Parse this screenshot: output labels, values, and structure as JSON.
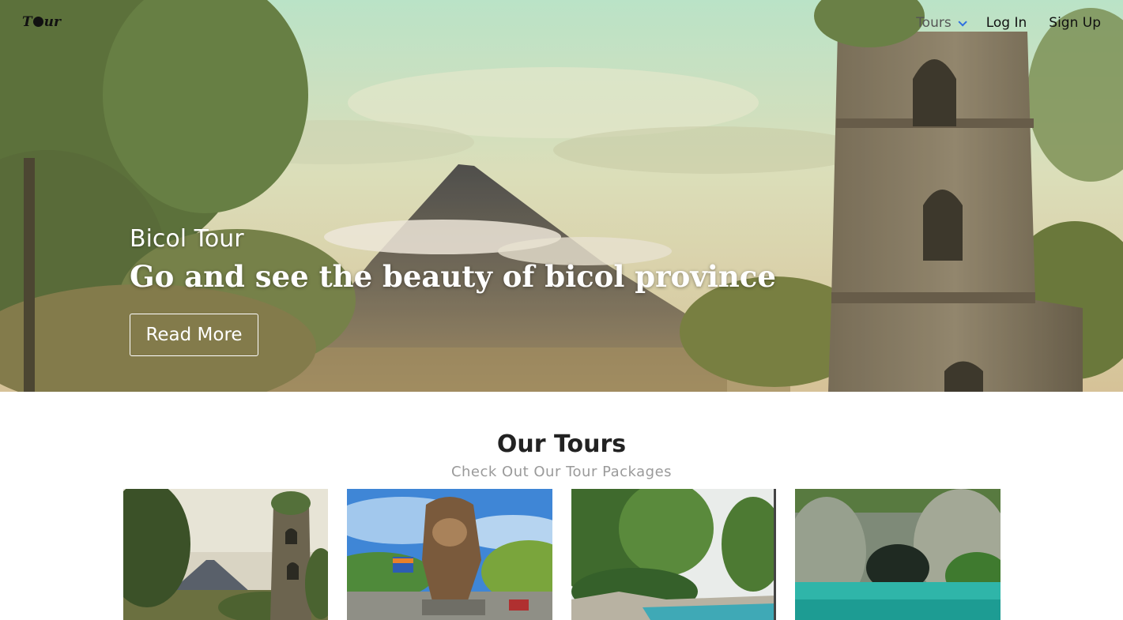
{
  "nav": {
    "logo": "Tour",
    "items": [
      {
        "label": "Tours"
      },
      {
        "label": "Log In"
      },
      {
        "label": "Sign Up"
      }
    ]
  },
  "hero": {
    "subtitle": "Bicol Tour",
    "title": "Go and see the beauty of bicol province",
    "button": "Read More"
  },
  "tours": {
    "title": "Our Tours",
    "subtitle": "Check Out Our Tour Packages",
    "cards": [
      {
        "image": "cagsawa-ruins-photo"
      },
      {
        "image": "lion-statue-photo"
      },
      {
        "image": "garden-pool-photo"
      },
      {
        "image": "underground-river-photo"
      }
    ]
  },
  "colors": {
    "accent": "#2f6fe0",
    "hero_text": "#ffffff",
    "heading": "#222222",
    "subheading": "#9a9a9a"
  }
}
